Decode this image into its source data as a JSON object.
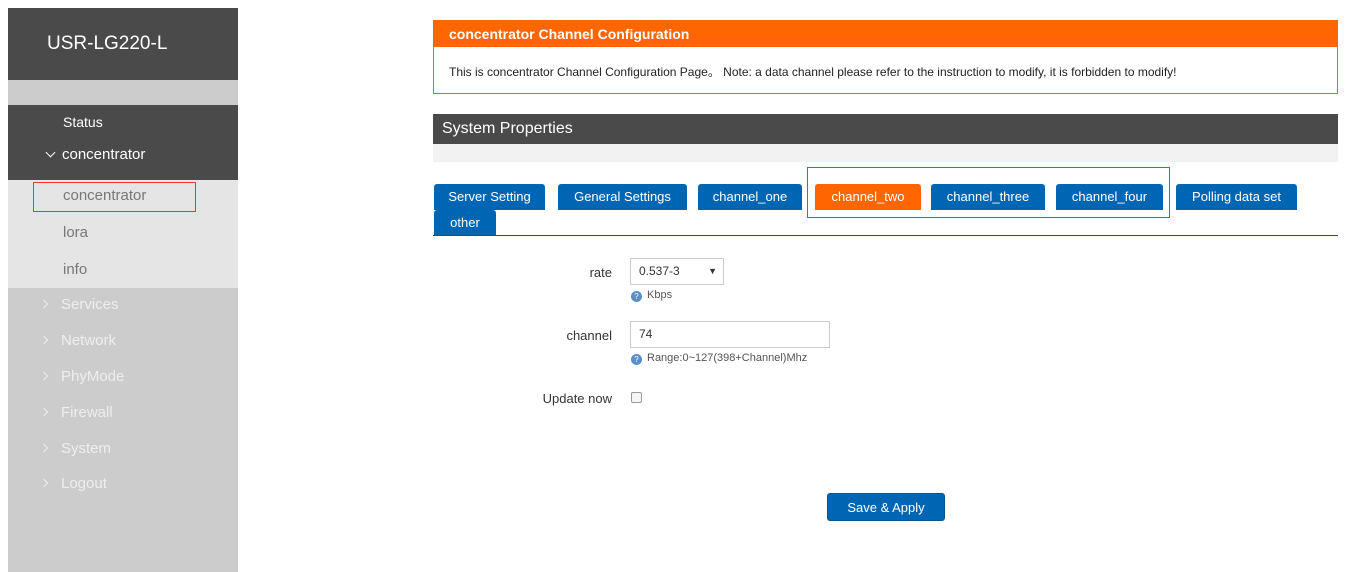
{
  "sidebar": {
    "brand": "USR-LG220-L",
    "status_label": "Status",
    "concentrator_label": "concentrator",
    "subitems": [
      "concentrator",
      "lora",
      "info"
    ],
    "menu": [
      "Services",
      "Network",
      "PhyMode",
      "Firewall",
      "System",
      "Logout"
    ]
  },
  "banner": {
    "title": "concentrator Channel Configuration",
    "text": "This is concentrator Channel Configuration Page。 Note: a data channel please refer to the instruction to modify, it is forbidden to modify!"
  },
  "section": {
    "title": "System Properties"
  },
  "tabs": [
    "Server Setting",
    "General Settings",
    "channel_one",
    "channel_two",
    "channel_three",
    "channel_four",
    "Polling data set",
    "other"
  ],
  "active_tab": "channel_two",
  "form": {
    "rate_label": "rate",
    "rate_value": "0.537-3",
    "rate_help": "Kbps",
    "channel_label": "channel",
    "channel_value": "74",
    "channel_help": "Range:0~127(398+Channel)Mhz",
    "update_label": "Update now",
    "update_checked": false
  },
  "actions": {
    "save_label": "Save & Apply"
  },
  "colors": {
    "accent": "#ff6600",
    "tab_blue": "#0066b3",
    "dark": "#4a4a4a"
  }
}
